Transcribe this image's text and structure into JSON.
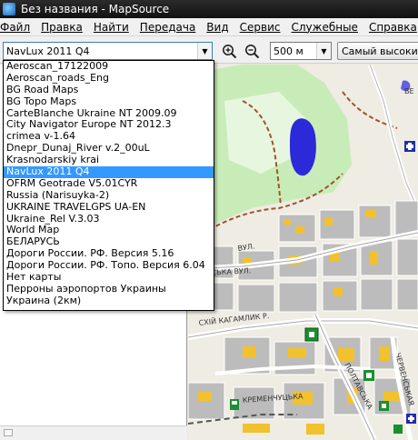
{
  "window": {
    "title": "Без названия - MapSource"
  },
  "menu": [
    "Файл",
    "Правка",
    "Найти",
    "Передача",
    "Вид",
    "Сервис",
    "Служебные",
    "Справка"
  ],
  "toolbar": {
    "map_combo_value": "NavLux 2011 Q4",
    "scale_value": "500 м",
    "detail_value": "Самый высокий"
  },
  "map_list": {
    "items": [
      "Aeroscan_17122009",
      "Aeroscan_roads_Eng",
      "BG Road Maps",
      "BG Topo Maps",
      "CarteBlanche Ukraine NT 2009.09",
      "City Navigator Europe NT 2012.3",
      "crimea v-1.64",
      "Dnepr_Dunaj_River v.2_00uL",
      "Krasnodarskiy krai",
      "NavLux 2011 Q4",
      "OFRM Geotrade V5.01CYR",
      "Russia (Narisuyka-2)",
      "UKRAINE TRAVELGPS UA-EN",
      "Ukraine_Rel V.3.03",
      "World Map",
      "БЕЛАРУСЬ",
      "Дороги России. РФ. Версия 5.16",
      "Дороги России. РФ. Топо. Версия 6.04",
      "Нет карты",
      "Перроны аэропортов Украины",
      "Украина (2км)"
    ],
    "selected_index": 9
  },
  "map_labels": {
    "street_1": "ВУЛ.",
    "street_2": "ЇВСЬКА ВУЛ.",
    "street_3": "СХІЙ КАГАМЛИК Р.",
    "street_4": "ПОЛТАВСЬКА",
    "street_5": "КРЕМЕНЧУЦЬКА",
    "street_6": "ЧЕРВЕНСЬКАЯ",
    "label_right": "ВЕ"
  },
  "colors": {
    "selected_bg": "#3399ff",
    "map_bg": "#efece4",
    "park": "#c8ecb8",
    "water": "#2a2ad8",
    "buildings": "#f2c12e",
    "blocks": "#bcbcbc"
  }
}
